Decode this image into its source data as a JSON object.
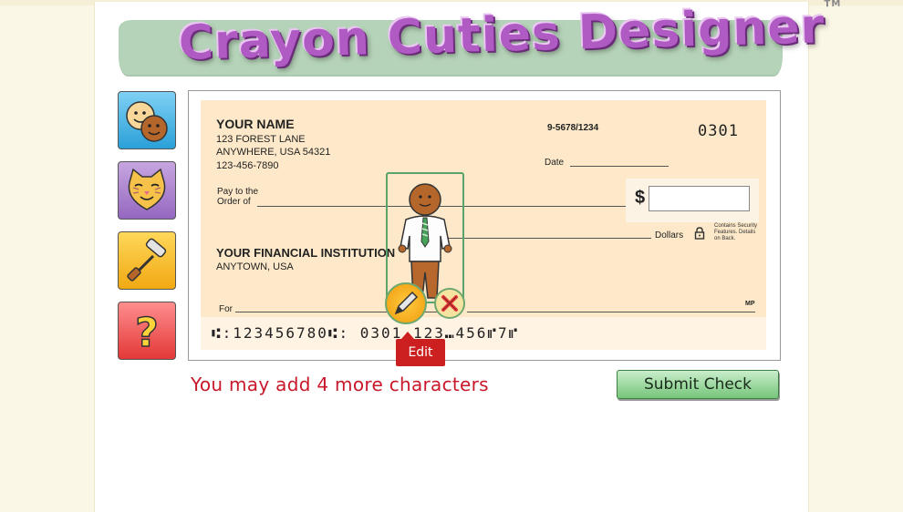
{
  "app": {
    "logo_text": "Crayon Cuties Designer",
    "trademark": "TM"
  },
  "tools": [
    {
      "name": "people",
      "icon": "faces-icon"
    },
    {
      "name": "animals",
      "icon": "cat-icon"
    },
    {
      "name": "paint",
      "icon": "paint-roller-icon"
    },
    {
      "name": "help",
      "icon": "question-icon"
    }
  ],
  "check": {
    "owner_name": "YOUR NAME",
    "address_line1": "123 FOREST LANE",
    "address_line2": "ANYWHERE, USA 54321",
    "phone": "123-456-7890",
    "routing_fraction": "9-5678/1234",
    "check_number": "0301",
    "date_label": "Date",
    "pay_to_label": "Pay to the\nOrder of",
    "dollar_sign": "$",
    "dollars_label": "Dollars",
    "security_note": "Contains Security\nFeatures. Details\non Back.",
    "bank_name": "YOUR FINANCIAL INSTITUTION",
    "bank_town": "ANYTOWN, USA",
    "for_label": "For",
    "mp_mark": "MP",
    "micr_line": "⑆:123456780⑆: 0301 123⑉456⑈7⑈"
  },
  "editor": {
    "edit_label": "Edit"
  },
  "status": {
    "remaining_text": "You may add 4 more characters"
  },
  "actions": {
    "submit_label": "Submit Check"
  },
  "colors": {
    "banner": "#b5d3b8",
    "check_bg": "#fde9c9",
    "accent_red": "#cc1f1f",
    "submit_green": "#76c57b"
  }
}
